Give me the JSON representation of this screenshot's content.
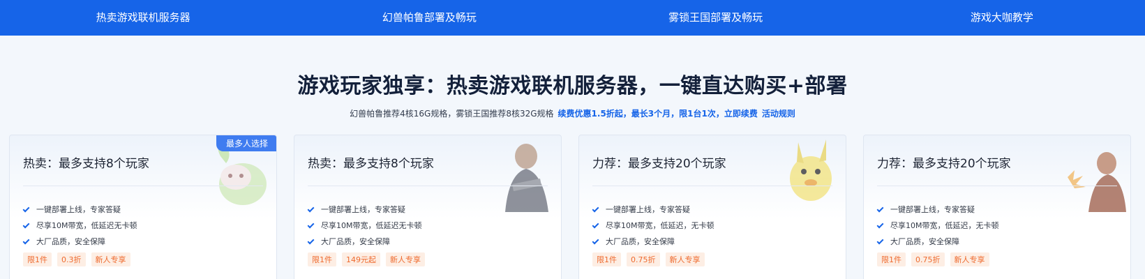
{
  "nav": {
    "items": [
      {
        "label": "热卖游戏联机服务器"
      },
      {
        "label": "幻兽帕鲁部署及畅玩"
      },
      {
        "label": "雾锁王国部署及畅玩"
      },
      {
        "label": "游戏大咖教学"
      }
    ]
  },
  "hero": {
    "title": "游戏玩家独享：热卖游戏联机服务器，一键直达购买+部署",
    "subtitle": "幻兽帕鲁推荐4核16G规格，雾锁王国推荐8核32G规格",
    "highlight": "续费优惠1.5折起，最长3个月，限1台1次，立即续费",
    "rules_link": "活动规则"
  },
  "colors": {
    "nav_bg": "#1664e8",
    "accent": "#1664e8",
    "tag_text": "#ee6a2e",
    "tag_bg": "#fdeee4"
  },
  "cards": [
    {
      "title": "热卖：最多支持8个玩家",
      "badge": "最多人选择",
      "features": [
        "一键部署上线，专家答疑",
        "尽享10M带宽，低延迟无卡顿",
        "大厂品质，安全保障"
      ],
      "tags": [
        "限1件",
        "0.3折",
        "新人专享"
      ],
      "art": "green-creature-icon"
    },
    {
      "title": "热卖：最多支持8个玩家",
      "badge": "",
      "features": [
        "一键部署上线，专家答疑",
        "尽享10M带宽，低延迟无卡顿",
        "大厂品质，安全保障"
      ],
      "tags": [
        "限1件",
        "149元起",
        "新人专享"
      ],
      "art": "warrior-icon"
    },
    {
      "title": "力荐：最多支持20个玩家",
      "badge": "",
      "features": [
        "一键部署上线，专家答疑",
        "尽享10M带宽，低延迟，无卡顿",
        "大厂品质，安全保障"
      ],
      "tags": [
        "限1件",
        "0.75折",
        "新人专享"
      ],
      "art": "yellow-creature-icon"
    },
    {
      "title": "力荐：最多支持20个玩家",
      "badge": "",
      "features": [
        "一键部署上线，专家答疑",
        "尽享10M带宽，低延迟，无卡顿",
        "大厂品质，安全保障"
      ],
      "tags": [
        "限1件",
        "0.75折",
        "新人专享"
      ],
      "art": "armored-knight-icon"
    }
  ]
}
